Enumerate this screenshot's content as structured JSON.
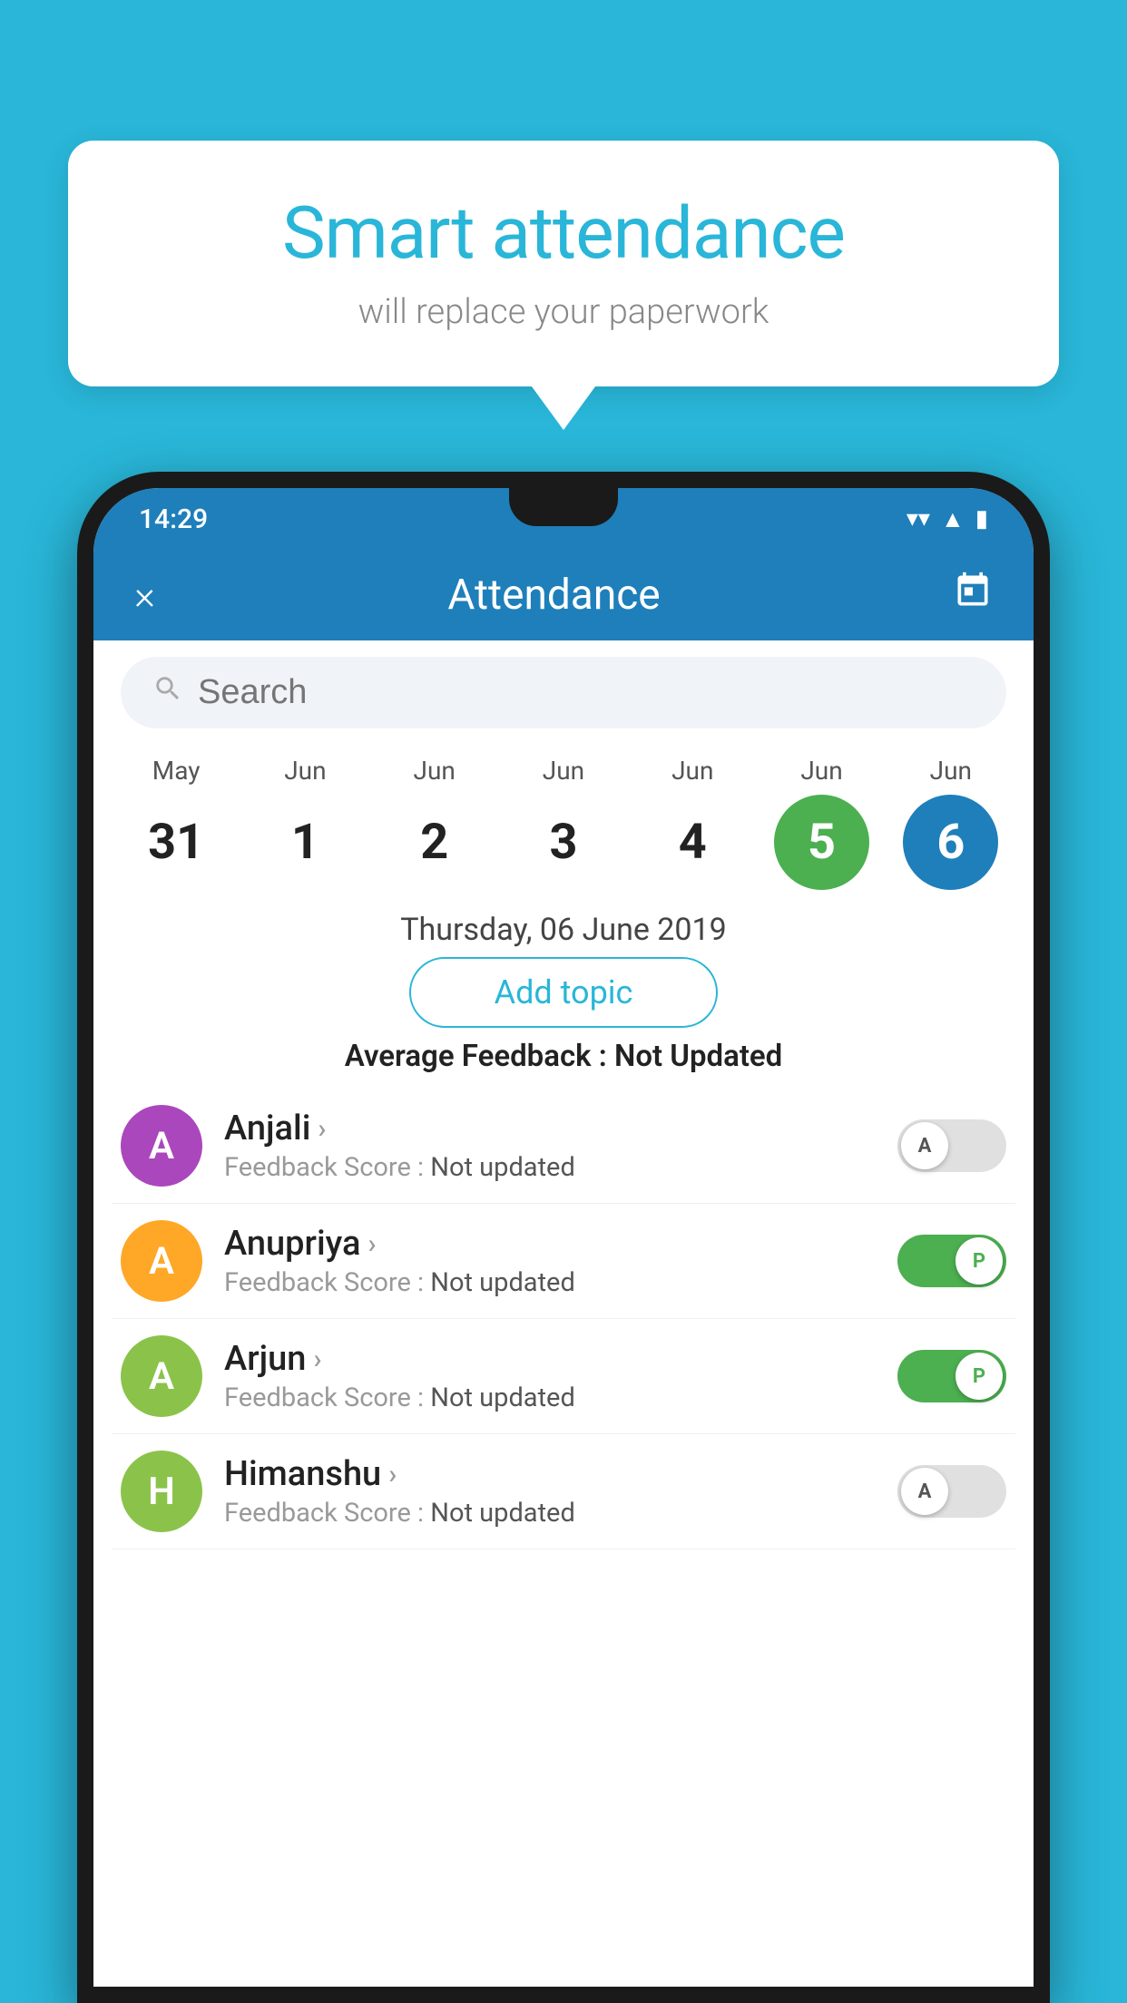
{
  "background_color": "#29b6d8",
  "bubble": {
    "title": "Smart attendance",
    "subtitle": "will replace your paperwork"
  },
  "status_bar": {
    "time": "14:29",
    "icons": [
      "wifi",
      "signal",
      "battery"
    ]
  },
  "app_bar": {
    "close_label": "×",
    "title": "Attendance",
    "calendar_icon": "📅"
  },
  "search": {
    "placeholder": "Search"
  },
  "calendar": {
    "days": [
      {
        "month": "May",
        "date": "31",
        "state": "normal"
      },
      {
        "month": "Jun",
        "date": "1",
        "state": "normal"
      },
      {
        "month": "Jun",
        "date": "2",
        "state": "normal"
      },
      {
        "month": "Jun",
        "date": "3",
        "state": "normal"
      },
      {
        "month": "Jun",
        "date": "4",
        "state": "normal"
      },
      {
        "month": "Jun",
        "date": "5",
        "state": "today"
      },
      {
        "month": "Jun",
        "date": "6",
        "state": "selected"
      }
    ]
  },
  "selected_date_label": "Thursday, 06 June 2019",
  "add_topic_label": "Add topic",
  "avg_feedback_label": "Average Feedback :",
  "avg_feedback_value": "Not Updated",
  "students": [
    {
      "name": "Anjali",
      "initial": "A",
      "avatar_color": "#ab47bc",
      "feedback_label": "Feedback Score :",
      "feedback_value": "Not updated",
      "toggle_state": "off",
      "toggle_letter": "A"
    },
    {
      "name": "Anupriya",
      "initial": "A",
      "avatar_color": "#ffa726",
      "feedback_label": "Feedback Score :",
      "feedback_value": "Not updated",
      "toggle_state": "on",
      "toggle_letter": "P"
    },
    {
      "name": "Arjun",
      "initial": "A",
      "avatar_color": "#8bc34a",
      "feedback_label": "Feedback Score :",
      "feedback_value": "Not updated",
      "toggle_state": "on",
      "toggle_letter": "P"
    },
    {
      "name": "Himanshu",
      "initial": "H",
      "avatar_color": "#8bc34a",
      "feedback_label": "Feedback Score :",
      "feedback_value": "Not updated",
      "toggle_state": "off",
      "toggle_letter": "A"
    }
  ]
}
